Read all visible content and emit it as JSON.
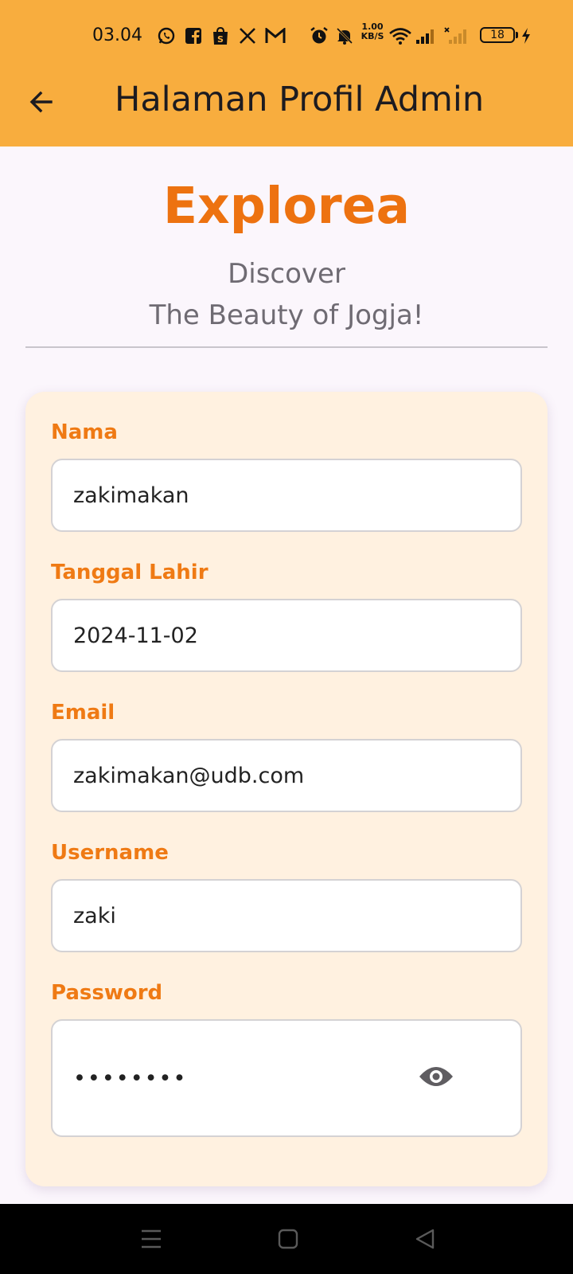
{
  "status_bar": {
    "time": "03.04",
    "net_speed_value": "1.00",
    "net_speed_unit": "KB/S",
    "battery": "18",
    "icons": [
      "whatsapp-icon",
      "facebook-icon",
      "shopee-icon",
      "x-icon",
      "gmail-icon",
      "alarm-icon",
      "mute-icon",
      "wifi-icon",
      "signal-icon",
      "signal-weak-icon",
      "charging-icon"
    ]
  },
  "app_bar": {
    "back_icon": "arrow-left-icon",
    "title": "Halaman Profil Admin",
    "background": "#f8ad3e"
  },
  "hero": {
    "brand": "Explorea",
    "tagline_line1": "Discover",
    "tagline_line2": "The Beauty of Jogja!",
    "brand_color": "#ed7210"
  },
  "form": {
    "card_background": "#fff1e0",
    "label_color": "#ef7a14",
    "fields": [
      {
        "label": "Nama",
        "value": "zakimakan"
      },
      {
        "label": "Tanggal Lahir",
        "value": "2024-11-02"
      },
      {
        "label": "Email",
        "value": "zakimakan@udb.com"
      },
      {
        "label": "Username",
        "value": "zaki"
      },
      {
        "label": "Password",
        "value": "••••••••"
      }
    ],
    "password_toggle_icon": "eye-icon"
  },
  "nav_bar": {
    "icons": [
      "menu-icon",
      "home-icon",
      "back-triangle-icon"
    ]
  }
}
